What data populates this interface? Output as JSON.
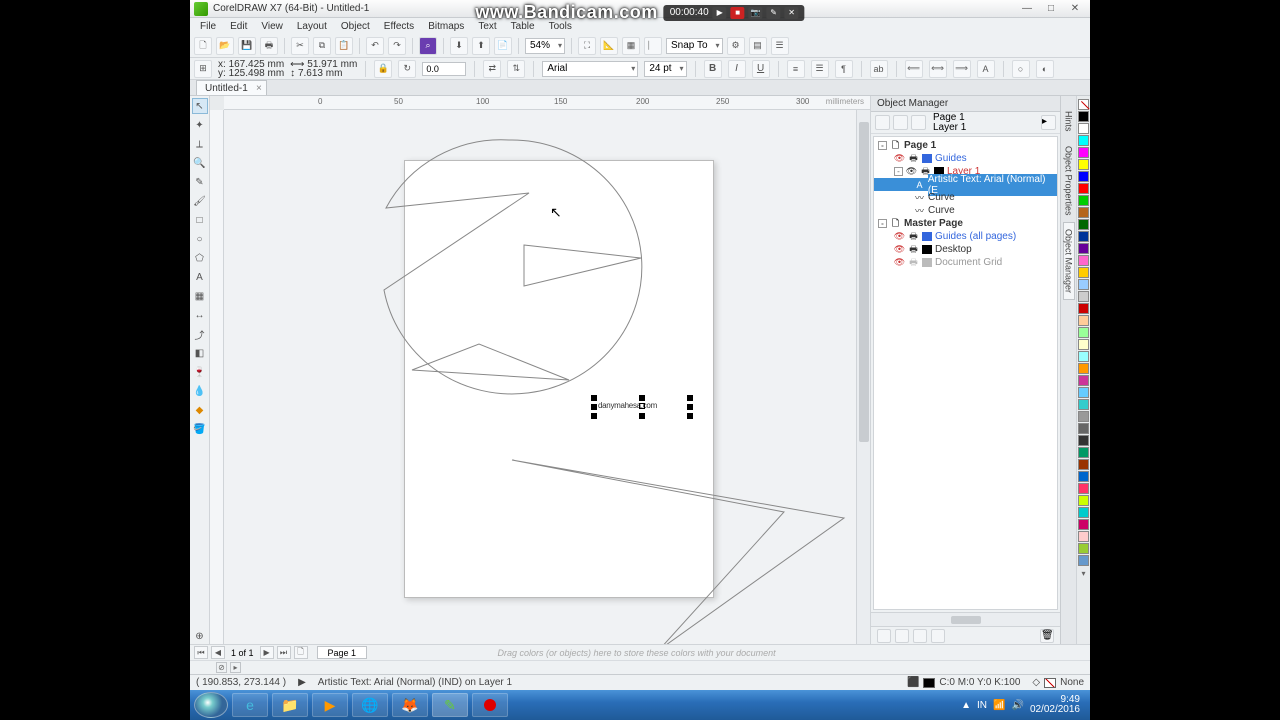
{
  "app": {
    "title": "CorelDRAW X7 (64-Bit) - Untitled-1"
  },
  "watermark": {
    "text": "www.Bandicam.com",
    "time": "00:00:40"
  },
  "menu": [
    "File",
    "Edit",
    "View",
    "Layout",
    "Object",
    "Effects",
    "Bitmaps",
    "Text",
    "Table",
    "Tools"
  ],
  "toolbar": {
    "zoom": "54%",
    "snap": "Snap To"
  },
  "prop": {
    "x": "167.425 mm",
    "y": "125.498 mm",
    "w": "51.971 mm",
    "h": "7.613 mm",
    "angle": "0.0",
    "font": "Arial",
    "size": "24 pt"
  },
  "docTab": "Untitled-1",
  "canvas": {
    "text": "danymahesa.com"
  },
  "ruler": {
    "marks": [
      "0",
      "50",
      "100",
      "150",
      "200",
      "250",
      "300"
    ],
    "unit": "millimeters"
  },
  "docker": {
    "title": "Object Manager",
    "pageSel": {
      "a": "Page 1",
      "b": "Layer 1"
    },
    "tree": {
      "page": "Page 1",
      "guides": "Guides",
      "layer": "Layer 1",
      "sel": "Artistic Text: Arial (Normal) (E",
      "curve1": "Curve",
      "curve2": "Curve",
      "master": "Master Page",
      "mguides": "Guides (all pages)",
      "desktop": "Desktop",
      "grid": "Document Grid"
    },
    "vtabs": [
      "Hints",
      "Object Properties",
      "Object Manager"
    ]
  },
  "pageNav": {
    "counter": "1 of 1",
    "tab": "Page 1",
    "hint": "Drag colors (or objects) here to store these colors with your document"
  },
  "status": {
    "coords": "( 190.853, 273.144 )",
    "obj": "Artistic Text: Arial (Normal) (IND) on Layer 1",
    "fill": "C:0 M:0 Y:0 K:100",
    "outline": "None"
  },
  "tray": {
    "lang": "IN",
    "time": "9:49",
    "date": "02/02/2016"
  }
}
